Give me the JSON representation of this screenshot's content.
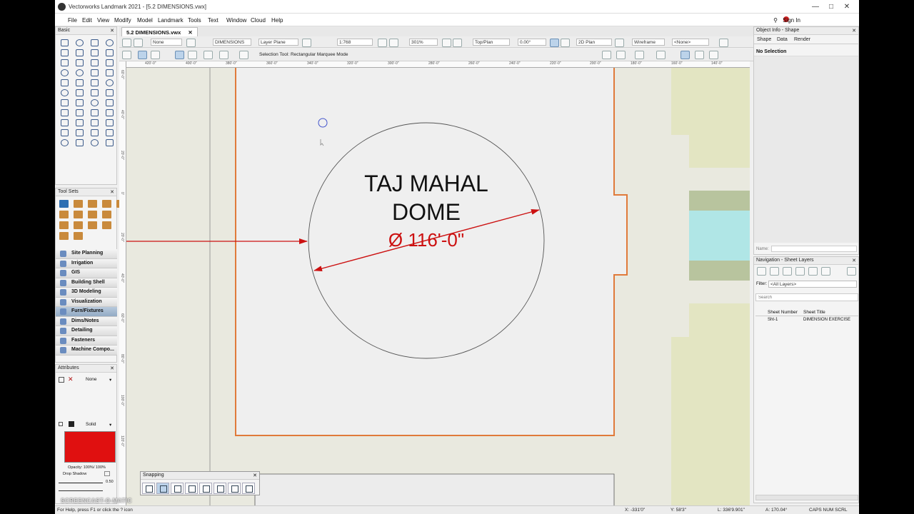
{
  "window": {
    "title": "Vectorworks Landmark 2021 - [5.2 DIMENSIONS.vwx]"
  },
  "menu": [
    "File",
    "Edit",
    "View",
    "Modify",
    "Model",
    "Landmark",
    "Tools",
    "Text",
    "Window",
    "Cloud",
    "Help"
  ],
  "sign_in": "Sign In",
  "basic_palette": {
    "title": "Basic"
  },
  "tool_sets_palette": {
    "title": "Tool Sets"
  },
  "tool_sets": [
    {
      "label": "Site Planning",
      "active": false
    },
    {
      "label": "Irrigation",
      "active": false
    },
    {
      "label": "GIS",
      "active": false
    },
    {
      "label": "Building Shell",
      "active": false
    },
    {
      "label": "3D Modeling",
      "active": false
    },
    {
      "label": "Visualization",
      "active": false
    },
    {
      "label": "Furn/Fixtures",
      "active": true
    },
    {
      "label": "Dims/Notes",
      "active": false
    },
    {
      "label": "Detailing",
      "active": false
    },
    {
      "label": "Fasteners",
      "active": false
    },
    {
      "label": "Machine Compo...",
      "active": false
    }
  ],
  "attributes": {
    "title": "Attributes",
    "fill_style": "None",
    "pen_style": "Solid",
    "pen_color": "#e01010",
    "opacity_label": "Opacity: 100%/ 100%",
    "drop_shadow": "Drop Shadow",
    "line_weight": "0.50"
  },
  "doc_tab": "5.2 DIMENSIONS.vwx",
  "view_bar": {
    "class": "None",
    "layer": "DIMENSIONS",
    "layer_plane": "Layer Plane",
    "scale": "1:768",
    "zoom": "301%",
    "view": "Top/Plan",
    "rotation": "0.00°",
    "plan": "2D Plan",
    "render_mode": "Wireframe",
    "saved_view": "<None>"
  },
  "mode_bar": {
    "label": "Selection Tool: Rectangular Marquee Mode"
  },
  "ruler_h": [
    "420'-0\"",
    "400'-0\"",
    "380'-0\"",
    "360'-0\"",
    "340'-0\"",
    "320'-0\"",
    "300'-0\"",
    "280'-0\"",
    "260'-0\"",
    "240'-0\"",
    "220'-0\"",
    "200'-0\"",
    "180'-0\"",
    "160'-0\"",
    "140'-0\""
  ],
  "ruler_v": [
    "60'-0\"",
    "40'-0\"",
    "20'-0\"",
    "0'",
    "20'-0\"",
    "40'-0\"",
    "60'-0\"",
    "80'-0\"",
    "100'-0\"",
    "120'-0\""
  ],
  "drawing": {
    "title_line1": "TAJ MAHAL",
    "title_line2": "DOME",
    "dimension": "Ø 116'-0\"",
    "accent": "#cc1111",
    "border_color": "#e07a3a",
    "garden_color": "#e3e5c2",
    "water_color": "#b0e6e6",
    "hedge_color": "#b8c49e"
  },
  "object_info": {
    "title": "Object Info - Shape",
    "tabs": [
      "Shape",
      "Data",
      "Render"
    ],
    "selection": "No Selection",
    "name_label": "Name:"
  },
  "navigation": {
    "title": "Navigation - Sheet Layers",
    "filter_label": "Filter:",
    "filter_value": "<All Layers>",
    "search_placeholder": "Search",
    "columns": [
      "Sheet Number",
      "Sheet Title"
    ],
    "rows": [
      {
        "number": "Sht-1",
        "title": "DIMENSION EXERCISE"
      }
    ]
  },
  "snapping": {
    "title": "Snapping"
  },
  "status": {
    "help": "For Help, press F1 or click the ? icon",
    "x": "X: -331'0\"",
    "y": "Y: 58'3\"",
    "length": "L: 336'9.901\"",
    "angle": "A: 170.04°",
    "indicators": "CAPS NUM SCRL"
  },
  "watermark": "SCREENCAST-O-MATIC"
}
